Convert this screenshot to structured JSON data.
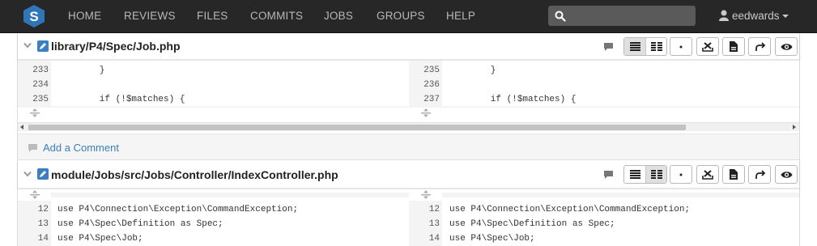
{
  "nav": {
    "items": [
      "HOME",
      "REVIEWS",
      "FILES",
      "COMMITS",
      "JOBS",
      "GROUPS",
      "HELP"
    ],
    "search_placeholder": "",
    "user": "eedwards"
  },
  "files": [
    {
      "path": "library/P4/Spec/Job.php",
      "left_lines": [
        {
          "num": "233",
          "code": "        }"
        },
        {
          "num": "234",
          "code": ""
        },
        {
          "num": "235",
          "code": "        if (!$matches) {"
        }
      ],
      "right_lines": [
        {
          "num": "235",
          "code": "        }"
        },
        {
          "num": "236",
          "code": ""
        },
        {
          "num": "237",
          "code": "        if (!$matches) {"
        }
      ],
      "add_comment": "Add a Comment"
    },
    {
      "path": "module/Jobs/src/Jobs/Controller/IndexController.php",
      "left_lines": [
        {
          "num": "12",
          "code": "use P4\\Connection\\Exception\\CommandException;"
        },
        {
          "num": "13",
          "code": "use P4\\Spec\\Definition as Spec;"
        },
        {
          "num": "14",
          "code": "use P4\\Spec\\Job;"
        }
      ],
      "right_lines": [
        {
          "num": "12",
          "code": "use P4\\Connection\\Exception\\CommandException;"
        },
        {
          "num": "13",
          "code": "use P4\\Spec\\Definition as Spec;"
        },
        {
          "num": "14",
          "code": "use P4\\Spec\\Job;"
        }
      ]
    }
  ],
  "icons": {
    "logo": "swarm-logo-icon",
    "search": "search-icon",
    "user": "user-icon",
    "collapse": "chevron-down-icon",
    "edit": "edit-file-icon",
    "comment": "comment-icon",
    "inline": "inline-diff-icon",
    "side_by_side": "side-by-side-diff-icon",
    "whitespace": "whitespace-icon",
    "download": "download-icon",
    "file": "file-icon",
    "open": "open-file-icon",
    "view": "eye-icon"
  },
  "colors": {
    "navbar": "#272727",
    "link": "#3a7fc1",
    "logo": "#2e76b8"
  }
}
